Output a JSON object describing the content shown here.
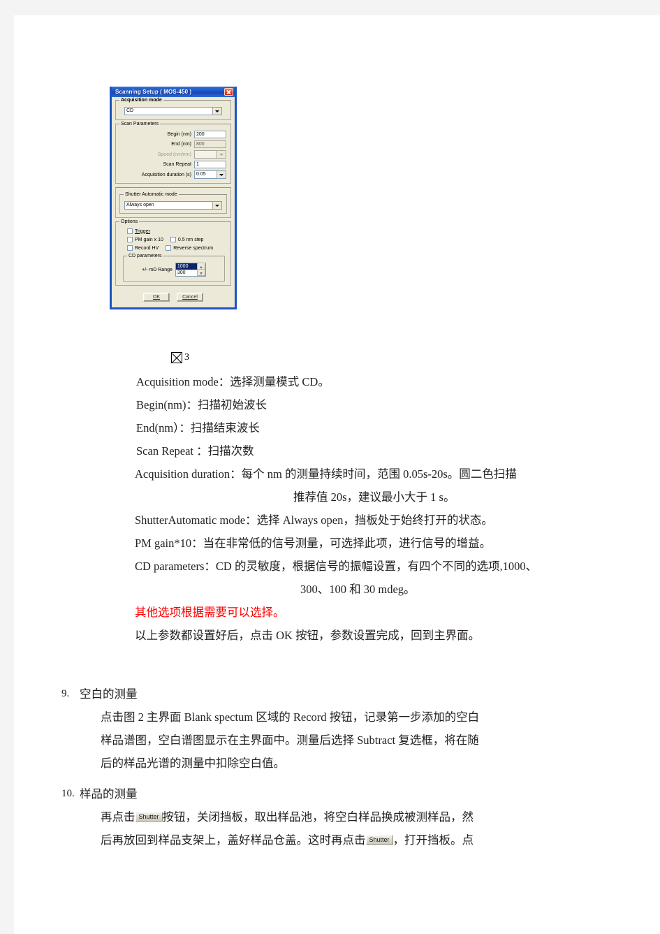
{
  "dialog": {
    "title": "Scanning Setup ( MOS-450 )",
    "close_icon": "close-icon",
    "acquisition_mode": {
      "legend": "Acquisition mode",
      "value": "CD"
    },
    "scan_parameters": {
      "legend": "Scan Parameters",
      "fields": [
        {
          "label": "Begin (nm)",
          "value": "200",
          "type": "text",
          "disabled": false
        },
        {
          "label": "End (nm)",
          "value": "800",
          "type": "text",
          "disabled": true
        },
        {
          "label": "Speed (nm/mn)",
          "value": "",
          "type": "combo",
          "disabled": true
        },
        {
          "label": "Scan Repeat",
          "value": "1",
          "type": "text",
          "disabled": false
        },
        {
          "label": "Acquisition duration (s)",
          "value": "0.05",
          "type": "combo",
          "disabled": false
        }
      ]
    },
    "shutter_mode": {
      "legend": "Shutter Automatic mode",
      "value": "Always open"
    },
    "options": {
      "legend": "Options",
      "items": [
        {
          "label": "Trigger",
          "checked": false
        },
        {
          "label": "PM gain x 10",
          "checked": false
        },
        {
          "label": "0.5 nm step",
          "checked": false
        },
        {
          "label": "Record HV",
          "checked": false
        },
        {
          "label": "Reverse spectrum",
          "checked": false
        }
      ]
    },
    "cd_parameters": {
      "legend": "CD parameters",
      "label": "+/- mD Range",
      "options": [
        "1000",
        "300"
      ],
      "selected": "1000"
    },
    "buttons": {
      "ok": "OK",
      "cancel": "Cancel"
    }
  },
  "caption": {
    "image_glyph": "image-placeholder-icon",
    "number": "3"
  },
  "body": {
    "lines": [
      "Acquisition  mode：选择测量模式 CD。",
      "Begin(nm)：扫描初始波长",
      "End(nm）：扫描结束波长",
      "Scan  Repeat  ：扫描次数",
      "Acquisition  duration：每个 nm 的测量持续时间，范围 0.05s-20s。圆二色扫描",
      "推荐值 20s，建议最小大于 1 s。",
      "ShutterAutomatic  mode：选择 Always open，挡板处于始终打开的状态。",
      "PM  gain*10：当在非常低的信号测量，可选择此项，进行信号的增益。",
      "CD  parameters：CD 的灵敏度，根据信号的振幅设置，有四个不同的选项,1000、",
      "300、100 和 30  mdeg。",
      "其他选项根据需要可以选择。",
      "以上参数都设置好后，点击 OK 按钮，参数设置完成，回到主界面。"
    ]
  },
  "section9": {
    "marker": "9.",
    "title": "空白的测量",
    "lines": [
      "点击图 2 主界面 Blank   spectum 区域的 Record 按钮，记录第一步添加的空白",
      "样品谱图，空白谱图显示在主界面中。测量后选择 Subtract 复选框，将在随",
      "后的样品光谱的测量中扣除空白值。"
    ]
  },
  "section10": {
    "marker": "10.",
    "title": "样品的测量",
    "line1_pre": "再点击",
    "shutter_label": "Shutter",
    "line1_post": "按钮，关闭挡板，取出样品池，将空白样品换成被测样品，然",
    "line2_pre": "后再放回到样品支架上，盖好样品仓盖。这时再点击",
    "line2_post": "，打开挡板。点"
  }
}
